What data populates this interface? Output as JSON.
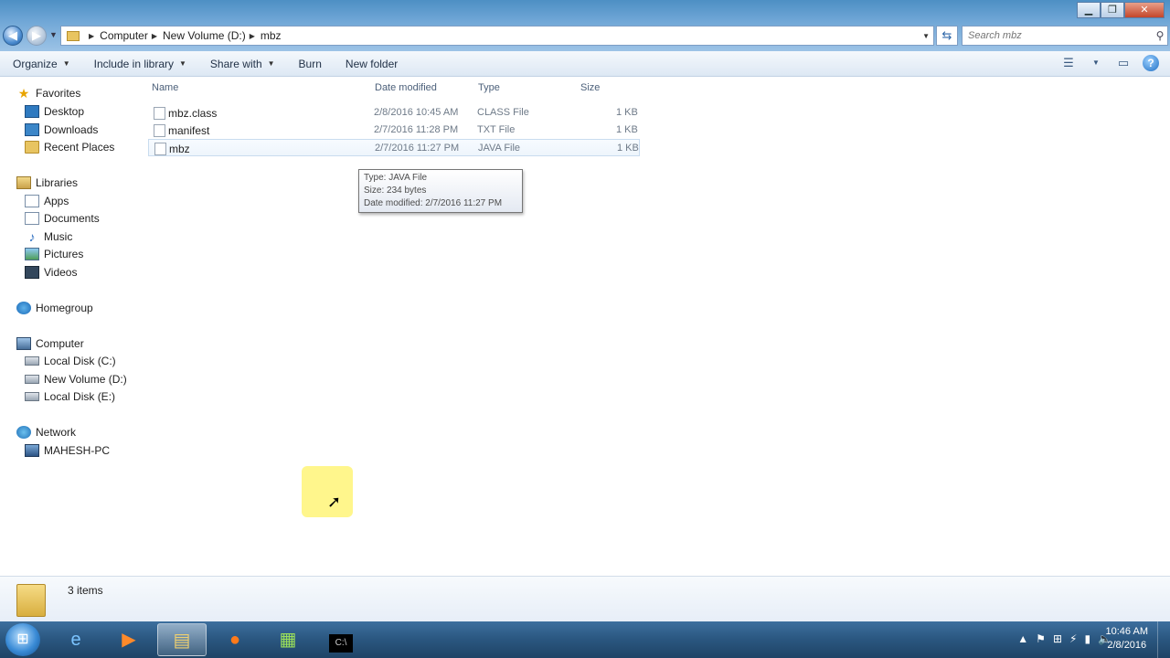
{
  "window": {
    "minimize": "▁",
    "maximize": "❐",
    "close": "✕"
  },
  "address": {
    "crumbs": [
      "Computer",
      "New Volume (D:)",
      "mbz"
    ]
  },
  "search": {
    "placeholder": "Search mbz"
  },
  "toolbar": {
    "organize": "Organize",
    "include": "Include in library",
    "share": "Share with",
    "burn": "Burn",
    "new_folder": "New folder"
  },
  "nav": {
    "favorites": "Favorites",
    "desktop": "Desktop",
    "downloads": "Downloads",
    "recent": "Recent Places",
    "libraries": "Libraries",
    "apps": "Apps",
    "documents": "Documents",
    "music": "Music",
    "pictures": "Pictures",
    "videos": "Videos",
    "homegroup": "Homegroup",
    "computer": "Computer",
    "disk_c": "Local Disk (C:)",
    "disk_d": "New Volume (D:)",
    "disk_e": "Local Disk (E:)",
    "network": "Network",
    "pc": "MAHESH-PC"
  },
  "columns": {
    "name": "Name",
    "date": "Date modified",
    "type": "Type",
    "size": "Size"
  },
  "files": [
    {
      "name": "mbz.class",
      "date": "2/8/2016 10:45 AM",
      "type": "CLASS File",
      "size": "1 KB"
    },
    {
      "name": "manifest",
      "date": "2/7/2016 11:28 PM",
      "type": "TXT File",
      "size": "1 KB"
    },
    {
      "name": "mbz",
      "date": "2/7/2016 11:27 PM",
      "type": "JAVA File",
      "size": "1 KB"
    }
  ],
  "tooltip": {
    "type": "Type: JAVA File",
    "size": "Size: 234 bytes",
    "date": "Date modified: 2/7/2016 11:27 PM"
  },
  "details": {
    "count": "3 items"
  },
  "taskbar": {
    "time": "10:46 AM",
    "date": "2/8/2016"
  }
}
